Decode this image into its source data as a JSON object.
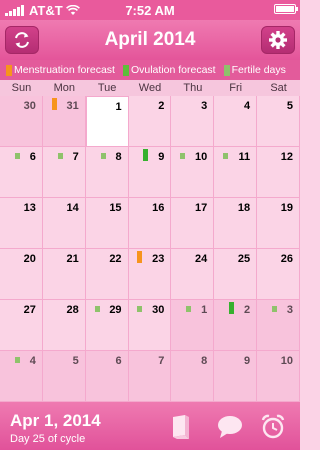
{
  "status_bar": {
    "carrier": "AT&T",
    "time": "7:52 AM"
  },
  "header": {
    "title": "April 2014",
    "refresh_icon": "refresh-icon",
    "settings_icon": "gear-icon"
  },
  "legend": [
    {
      "label": "Menstruation forecast",
      "color": "#f7941d"
    },
    {
      "label": "Ovulation forecast",
      "color": "#5cbf3a"
    },
    {
      "label": "Fertile days",
      "color": "#8fc26b"
    }
  ],
  "weekdays": [
    "Sun",
    "Mon",
    "Tue",
    "Wed",
    "Thu",
    "Fri",
    "Sat"
  ],
  "colors": {
    "menstruation": "#f7941d",
    "ovulation": "#36b02e",
    "fertile": "#8fc26b",
    "accent": "#e4559a"
  },
  "days": [
    {
      "day": "30",
      "in_month": false
    },
    {
      "day": "31",
      "in_month": false,
      "mark": "menstruation"
    },
    {
      "day": "1",
      "in_month": true,
      "today": true
    },
    {
      "day": "2",
      "in_month": true
    },
    {
      "day": "3",
      "in_month": true
    },
    {
      "day": "4",
      "in_month": true
    },
    {
      "day": "5",
      "in_month": true
    },
    {
      "day": "6",
      "in_month": true,
      "mark": "fertile"
    },
    {
      "day": "7",
      "in_month": true,
      "mark": "fertile"
    },
    {
      "day": "8",
      "in_month": true,
      "mark": "fertile"
    },
    {
      "day": "9",
      "in_month": true,
      "mark": "ovulation"
    },
    {
      "day": "10",
      "in_month": true,
      "mark": "fertile"
    },
    {
      "day": "11",
      "in_month": true,
      "mark": "fertile"
    },
    {
      "day": "12",
      "in_month": true
    },
    {
      "day": "13",
      "in_month": true
    },
    {
      "day": "14",
      "in_month": true
    },
    {
      "day": "15",
      "in_month": true
    },
    {
      "day": "16",
      "in_month": true
    },
    {
      "day": "17",
      "in_month": true
    },
    {
      "day": "18",
      "in_month": true
    },
    {
      "day": "19",
      "in_month": true
    },
    {
      "day": "20",
      "in_month": true
    },
    {
      "day": "21",
      "in_month": true
    },
    {
      "day": "22",
      "in_month": true
    },
    {
      "day": "23",
      "in_month": true,
      "mark": "menstruation"
    },
    {
      "day": "24",
      "in_month": true
    },
    {
      "day": "25",
      "in_month": true
    },
    {
      "day": "26",
      "in_month": true
    },
    {
      "day": "27",
      "in_month": true
    },
    {
      "day": "28",
      "in_month": true
    },
    {
      "day": "29",
      "in_month": true,
      "mark": "fertile"
    },
    {
      "day": "30",
      "in_month": true,
      "mark": "fertile"
    },
    {
      "day": "1",
      "in_month": false,
      "mark": "fertile"
    },
    {
      "day": "2",
      "in_month": false,
      "mark": "ovulation"
    },
    {
      "day": "3",
      "in_month": false,
      "mark": "fertile"
    },
    {
      "day": "4",
      "in_month": false,
      "mark": "fertile"
    },
    {
      "day": "5",
      "in_month": false
    },
    {
      "day": "6",
      "in_month": false
    },
    {
      "day": "7",
      "in_month": false
    },
    {
      "day": "8",
      "in_month": false
    },
    {
      "day": "9",
      "in_month": false
    },
    {
      "day": "10",
      "in_month": false
    }
  ],
  "footer": {
    "selected_date": "Apr 1, 2014",
    "cycle_text": "Day 25 of cycle",
    "icons": [
      "book-icon",
      "speech-bubble-icon",
      "alarm-clock-icon"
    ]
  }
}
